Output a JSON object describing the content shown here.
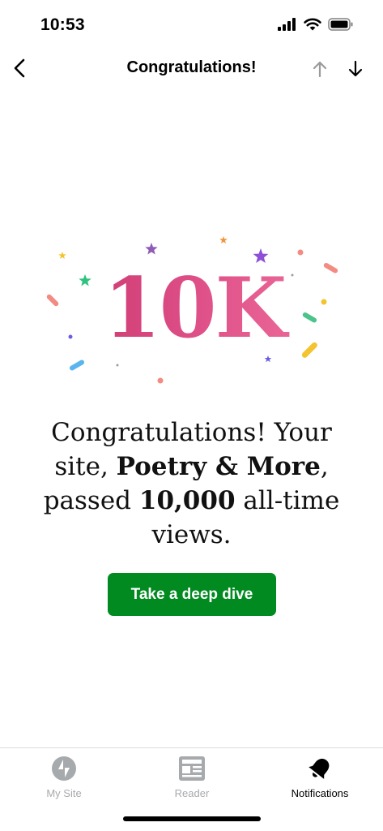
{
  "status_bar": {
    "time": "10:53"
  },
  "nav": {
    "title": "Congratulations!",
    "icons": {
      "back": "chevron-left-icon",
      "previous": "arrow-up-icon",
      "next": "arrow-down-icon"
    }
  },
  "milestone": {
    "label": "10K"
  },
  "message": {
    "prefix": "Congratulations! Your site, ",
    "site_name": "Poetry & More",
    "middle": ", passed ",
    "views_count": "10,000",
    "suffix": " all-time views."
  },
  "cta": {
    "label": "Take a deep dive",
    "color": "#008a20"
  },
  "colors": {
    "milestone_gradient_start": "#c9336b",
    "milestone_gradient_end": "#f0739f",
    "tab_inactive": "#a7aaad"
  },
  "tabs": [
    {
      "label": "My Site",
      "icon": "jetpack-bolt-icon",
      "active": false
    },
    {
      "label": "Reader",
      "icon": "reader-icon",
      "active": false
    },
    {
      "label": "Notifications",
      "icon": "bell-icon",
      "active": true
    }
  ]
}
